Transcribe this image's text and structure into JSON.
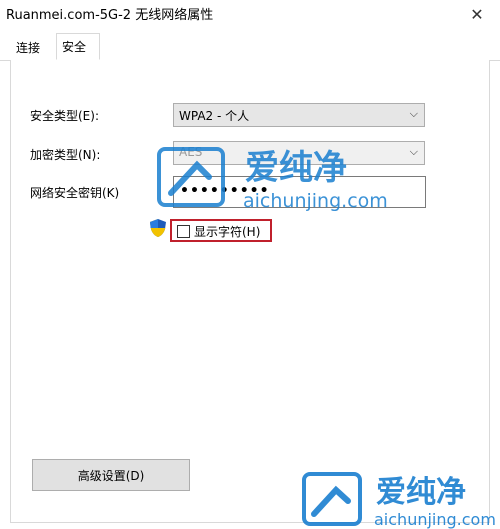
{
  "window": {
    "title": "Ruanmei.com-5G-2 无线网络属性",
    "close_glyph": "✕"
  },
  "tabs": [
    {
      "label": "连接"
    },
    {
      "label": "安全"
    }
  ],
  "security": {
    "type_label": "安全类型(E):",
    "type_value": "WPA2 - 个人",
    "encryption_label": "加密类型(N):",
    "encryption_value": "AES",
    "key_label": "网络安全密钥(K)",
    "key_value": "•••••••••",
    "show_chars_label": "显示字符(H)",
    "show_chars_checked": false,
    "highlight_color": "#c0202c"
  },
  "buttons": {
    "advanced_label": "高级设置(D)"
  },
  "watermark": {
    "brand_cn": "爱纯净",
    "brand_url": "aichunjing.com",
    "color": "#1a7fd0"
  },
  "icons": {
    "close": "close-icon",
    "dropdown": "chevron-down-icon",
    "shield": "uac-shield-icon"
  }
}
